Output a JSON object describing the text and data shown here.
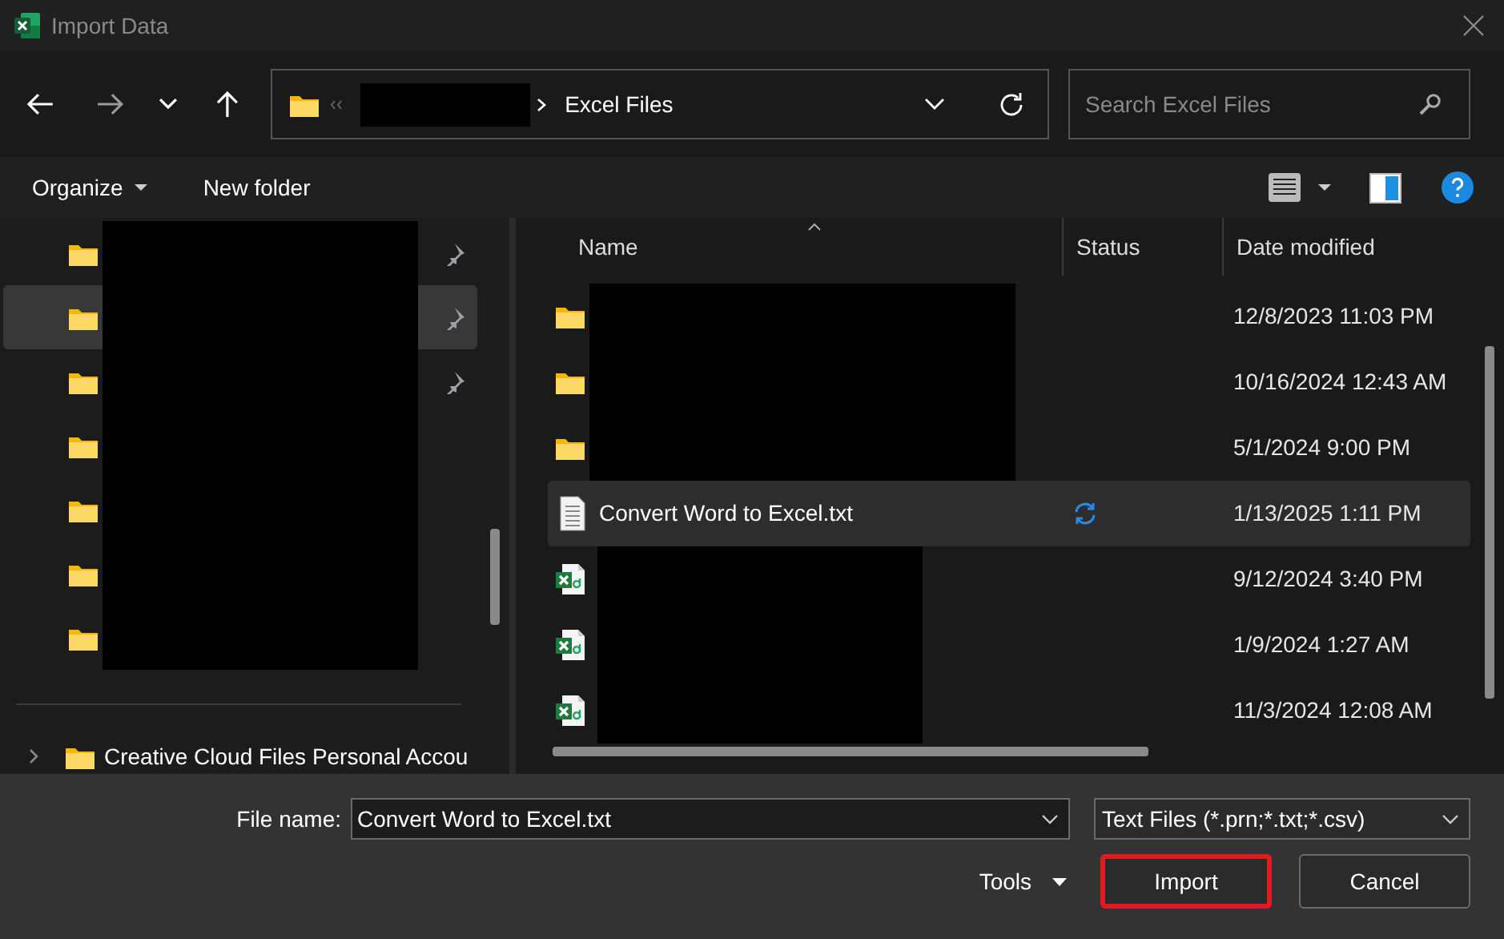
{
  "window": {
    "title": "Import Data"
  },
  "address_bar": {
    "folder": "Excel Files"
  },
  "search": {
    "placeholder": "Search Excel Files"
  },
  "toolbar": {
    "organize": "Organize",
    "new_folder": "New folder"
  },
  "sidebar": {
    "items": [
      {
        "pinned": true,
        "selected": false
      },
      {
        "pinned": true,
        "selected": true
      },
      {
        "pinned": true,
        "selected": false
      },
      {
        "pinned": false,
        "selected": false
      },
      {
        "pinned": false,
        "selected": false
      },
      {
        "pinned": false,
        "selected": false
      },
      {
        "pinned": false,
        "selected": false
      }
    ],
    "footer_item": {
      "label": "Creative Cloud Files Personal Accou",
      "expanded": false
    }
  },
  "file_list": {
    "columns": [
      "Name",
      "Status",
      "Date modified"
    ],
    "rows": [
      {
        "kind": "folder",
        "date": "12/8/2023 11:03 PM",
        "syncing": false,
        "selected": false
      },
      {
        "kind": "folder",
        "date": "10/16/2024 12:43 AM",
        "syncing": false,
        "selected": false
      },
      {
        "kind": "folder",
        "date": "5/1/2024 9:00 PM",
        "syncing": false,
        "selected": false
      },
      {
        "kind": "text",
        "name": "Convert Word to Excel.txt",
        "date": "1/13/2025 1:11 PM",
        "syncing": true,
        "selected": true
      },
      {
        "kind": "excel",
        "date": "9/12/2024 3:40 PM",
        "syncing": false,
        "selected": false
      },
      {
        "kind": "excel",
        "date": "1/9/2024 1:27 AM",
        "syncing": false,
        "selected": false
      },
      {
        "kind": "excel",
        "date": "11/3/2024 12:08 AM",
        "syncing": false,
        "selected": false
      }
    ]
  },
  "footer": {
    "file_name_label": "File name:",
    "file_name": "Convert Word to Excel.txt",
    "file_type": "Text Files (*.prn;*.txt;*.csv)",
    "tools": "Tools",
    "buttons": [
      {
        "label": "Import",
        "highlighted": true
      },
      {
        "label": "Cancel",
        "highlighted": false
      }
    ]
  }
}
